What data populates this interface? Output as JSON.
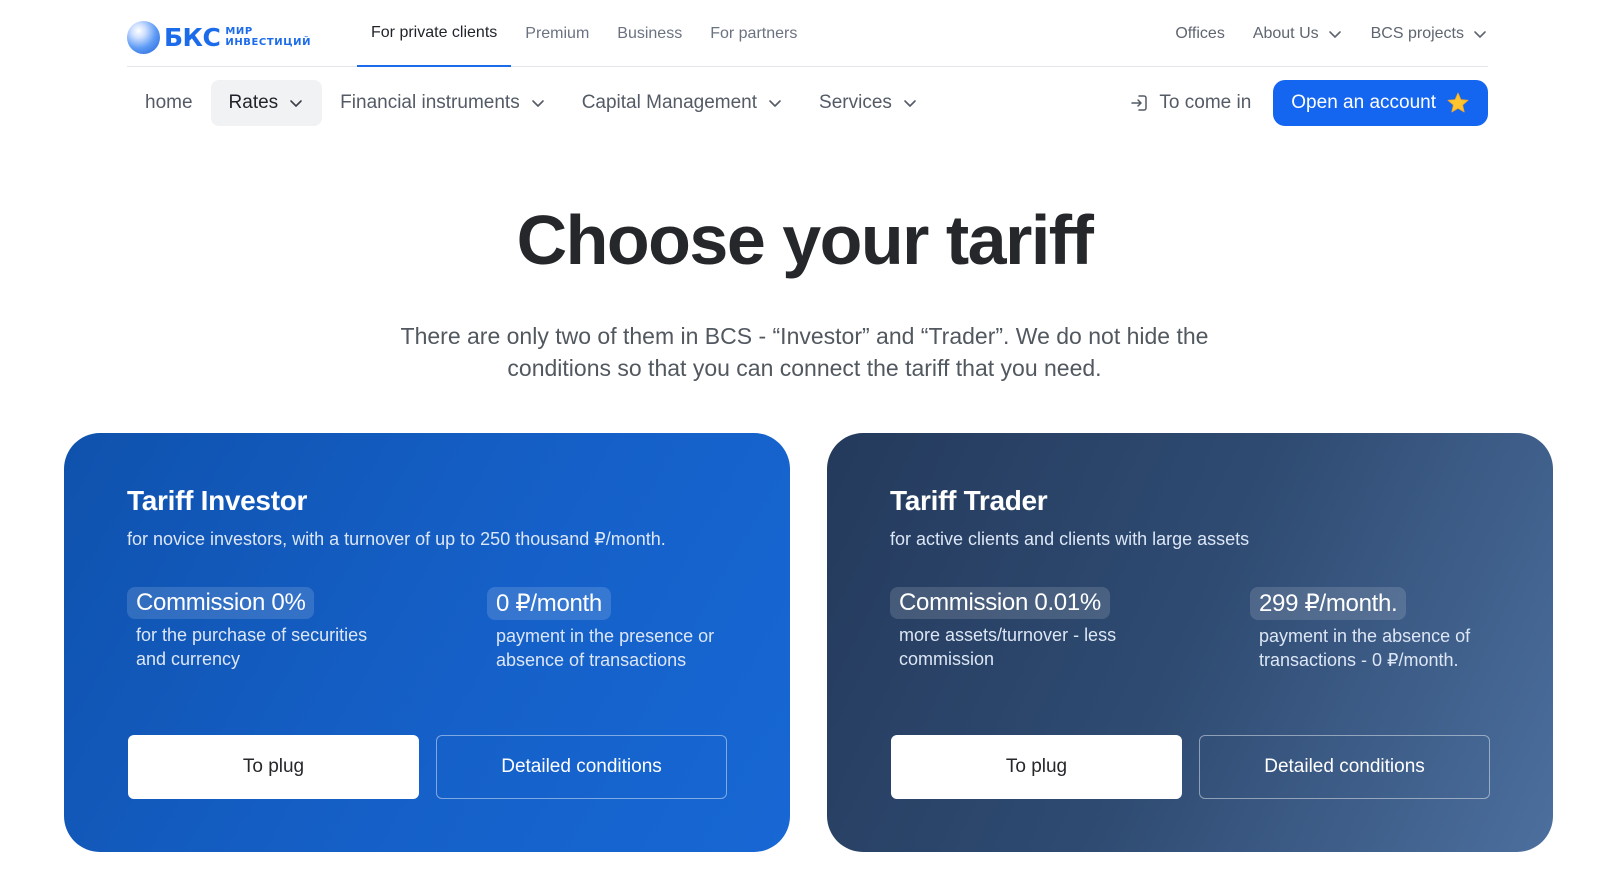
{
  "brand": {
    "name": "БКС",
    "tagline_line1": "МИР",
    "tagline_line2": "ИНВЕСТИЦИЙ"
  },
  "segment_tabs": [
    {
      "label": "For private clients",
      "active": true
    },
    {
      "label": "Premium",
      "active": false
    },
    {
      "label": "Business",
      "active": false
    },
    {
      "label": "For partners",
      "active": false
    }
  ],
  "top_right": {
    "offices": "Offices",
    "about": "About Us",
    "projects": "BCS projects"
  },
  "nav": {
    "home": "home",
    "rates": "Rates",
    "financial": "Financial instruments",
    "capital": "Capital Management",
    "services": "Services",
    "login": "To come in",
    "open_account": "Open an account"
  },
  "hero": {
    "title": "Choose your tariff",
    "subtitle": "There are only two of them in BCS - “Investor” and “Trader”. We do not hide the conditions so that you can connect the tariff that you need."
  },
  "cards": [
    {
      "title": "Tariff Investor",
      "subtitle": "for novice investors, with a turnover of up to 250 thousand ₽/month.",
      "feature1": {
        "value": "Commission 0%",
        "desc": "for the purchase of securities and currency"
      },
      "feature2": {
        "value": "0 ₽/month",
        "desc": "payment in the presence or absence of transactions"
      },
      "plug_label": "To plug",
      "detail_label": "Detailed conditions"
    },
    {
      "title": "Tariff Trader",
      "subtitle": "for active clients and clients with large assets",
      "feature1": {
        "value": "Commission 0.01%",
        "desc": "more assets/turnover - less commission"
      },
      "feature2": {
        "value": "299 ₽/month.",
        "desc": "payment in the absence of transactions - 0 ₽/month."
      },
      "plug_label": "To plug",
      "detail_label": "Detailed conditions"
    }
  ],
  "colors": {
    "accent": "#1466f0",
    "investor_card": "#1560c8",
    "trader_card": "#2f4b72"
  },
  "icons": {
    "login": "login-arrow-icon",
    "star": "star-icon",
    "chevron": "chevron-down-icon"
  }
}
